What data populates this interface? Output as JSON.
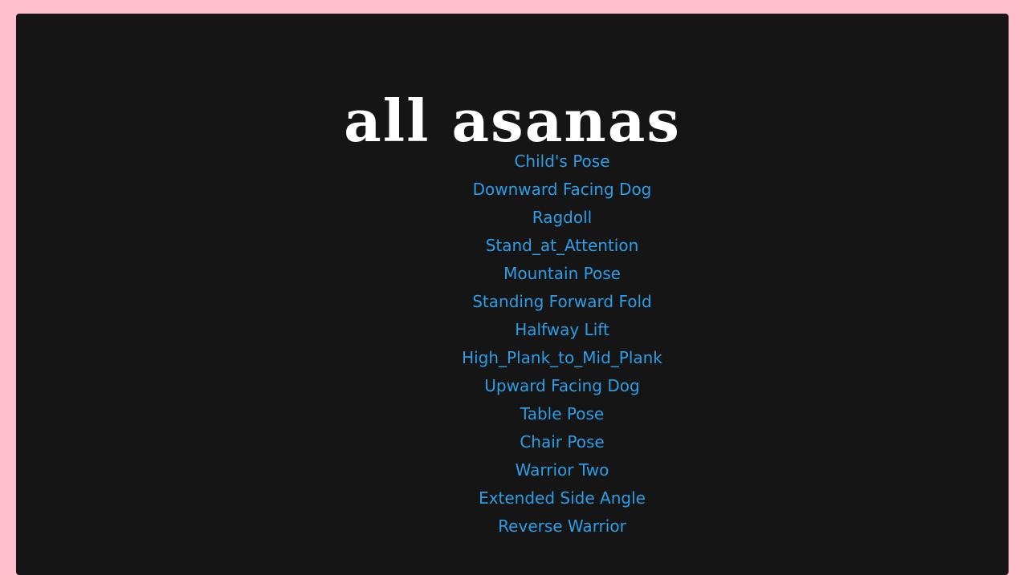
{
  "page": {
    "title": "all asanas",
    "colors": {
      "background": "#ffc0cb",
      "card": "#151515",
      "link": "#2d9ee6",
      "title": "#ffffff"
    }
  },
  "asanas": [
    "Child's Pose",
    "Downward Facing Dog",
    "Ragdoll",
    "Stand_at_Attention",
    "Mountain Pose",
    "Standing Forward Fold",
    "Halfway Lift",
    "High_Plank_to_Mid_Plank",
    "Upward Facing Dog",
    "Table Pose",
    "Chair Pose",
    "Warrior Two",
    "Extended Side Angle",
    "Reverse Warrior"
  ]
}
